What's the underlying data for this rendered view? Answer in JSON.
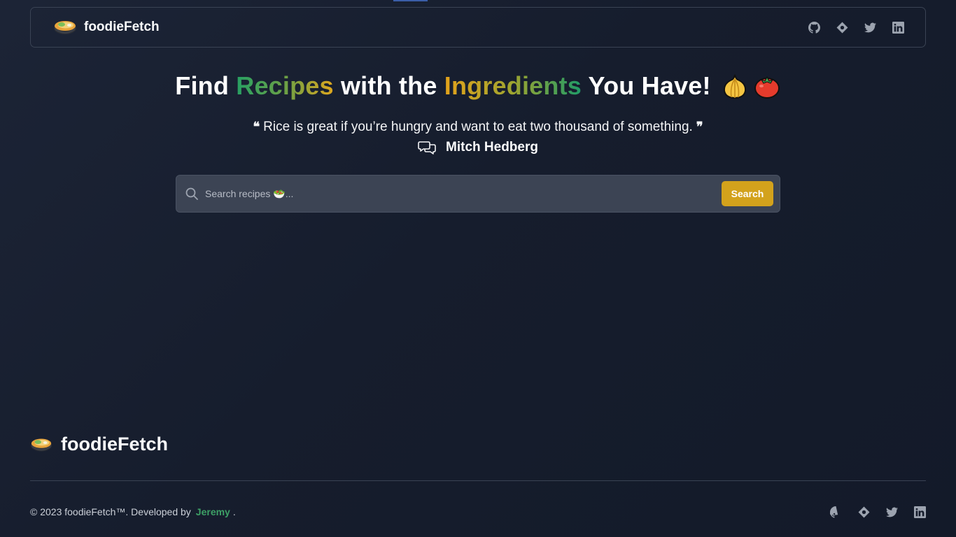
{
  "brand": {
    "name": "foodieFetch",
    "logo_icon": "bowl-icon"
  },
  "nav": {
    "social": [
      {
        "name": "github-icon"
      },
      {
        "name": "website-icon"
      },
      {
        "name": "twitter-icon"
      },
      {
        "name": "linkedin-icon"
      }
    ]
  },
  "hero": {
    "part1": "Find ",
    "recipes": "Recipes",
    "part2": " with the ",
    "ingredients": "Ingredients",
    "part3": " You Have!",
    "emoji_onion": "🧅",
    "emoji_tomato": "🍅"
  },
  "quote": {
    "text": "Rice is great if you’re hungry and want to eat two thousand of something.",
    "open_mark": "❝",
    "close_mark": "❞",
    "author": "Mitch Hedberg"
  },
  "search": {
    "placeholder": "Search recipes 🥗...",
    "button_label": "Search"
  },
  "footer": {
    "brand": "foodieFetch",
    "copyright": "© 2023 foodieFetch™. Developed by",
    "developer": "Jeremy",
    "period": "."
  },
  "colors": {
    "background": "#161d2d",
    "accent_gold": "#d3a21c",
    "accent_green": "#3da066",
    "border": "#3a4354"
  }
}
